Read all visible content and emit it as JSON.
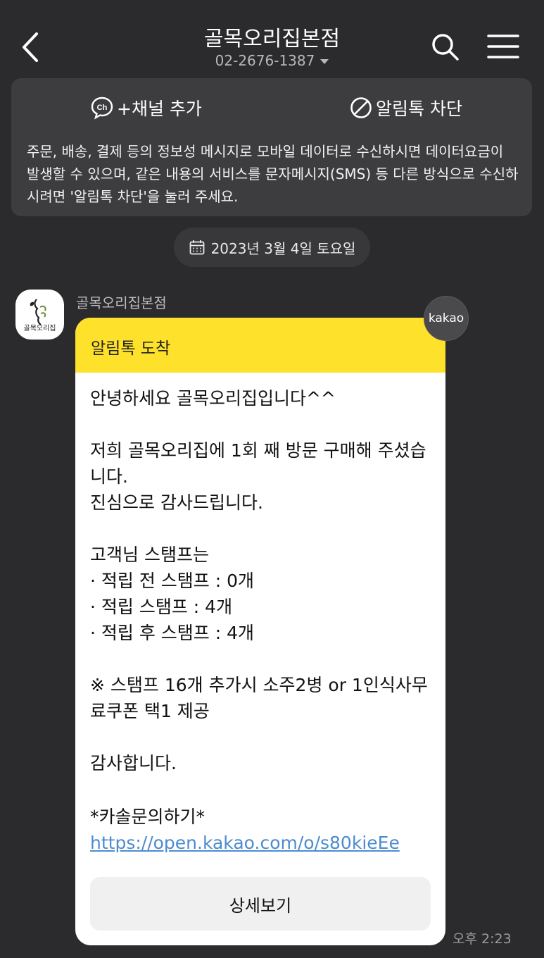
{
  "header": {
    "title": "골목오리집본점",
    "phone": "02-2676-1387"
  },
  "notice": {
    "add_channel_label": "+채널 추가",
    "block_label": "알림톡 차단",
    "text": "주문, 배송, 결제 등의 정보성 메시지로 모바일 데이터로 수신하시면 데이터요금이 발생할 수 있으며, 같은 내용의 서비스를 문자메시지(SMS) 등 다른 방식으로 수신하시려면 '알림톡 차단'을 눌러 주세요."
  },
  "date_divider": "2023년 3월 4일 토요일",
  "sender": {
    "name": "골목오리집본점",
    "avatar_text": "골목오리집"
  },
  "kakao_badge": "kakao",
  "message": {
    "header": "알림톡 도착",
    "body": "안녕하세요 골목오리집입니다^^\n\n저희 골목오리집에 1회 째 방문 구매해 주셨습니다.\n진심으로 감사드립니다.\n\n고객님 스탬프는\n· 적립 전 스탬프 : 0개\n· 적립 스탬프 : 4개\n· 적립 후 스탬프 : 4개\n\n※ 스탬프 16개 추가시 소주2병 or 1인식사무료쿠폰 택1 제공\n\n감사합니다.",
    "link_prefix": "*카솔문의하기* ",
    "link_url": "https://open.kakao.com/o/s80kieEe",
    "detail_button": "상세보기"
  },
  "time": "오후 2:23",
  "colors": {
    "background": "#2b2b2e",
    "bubble_header": "#fde12a",
    "link": "#4c8ccf"
  }
}
